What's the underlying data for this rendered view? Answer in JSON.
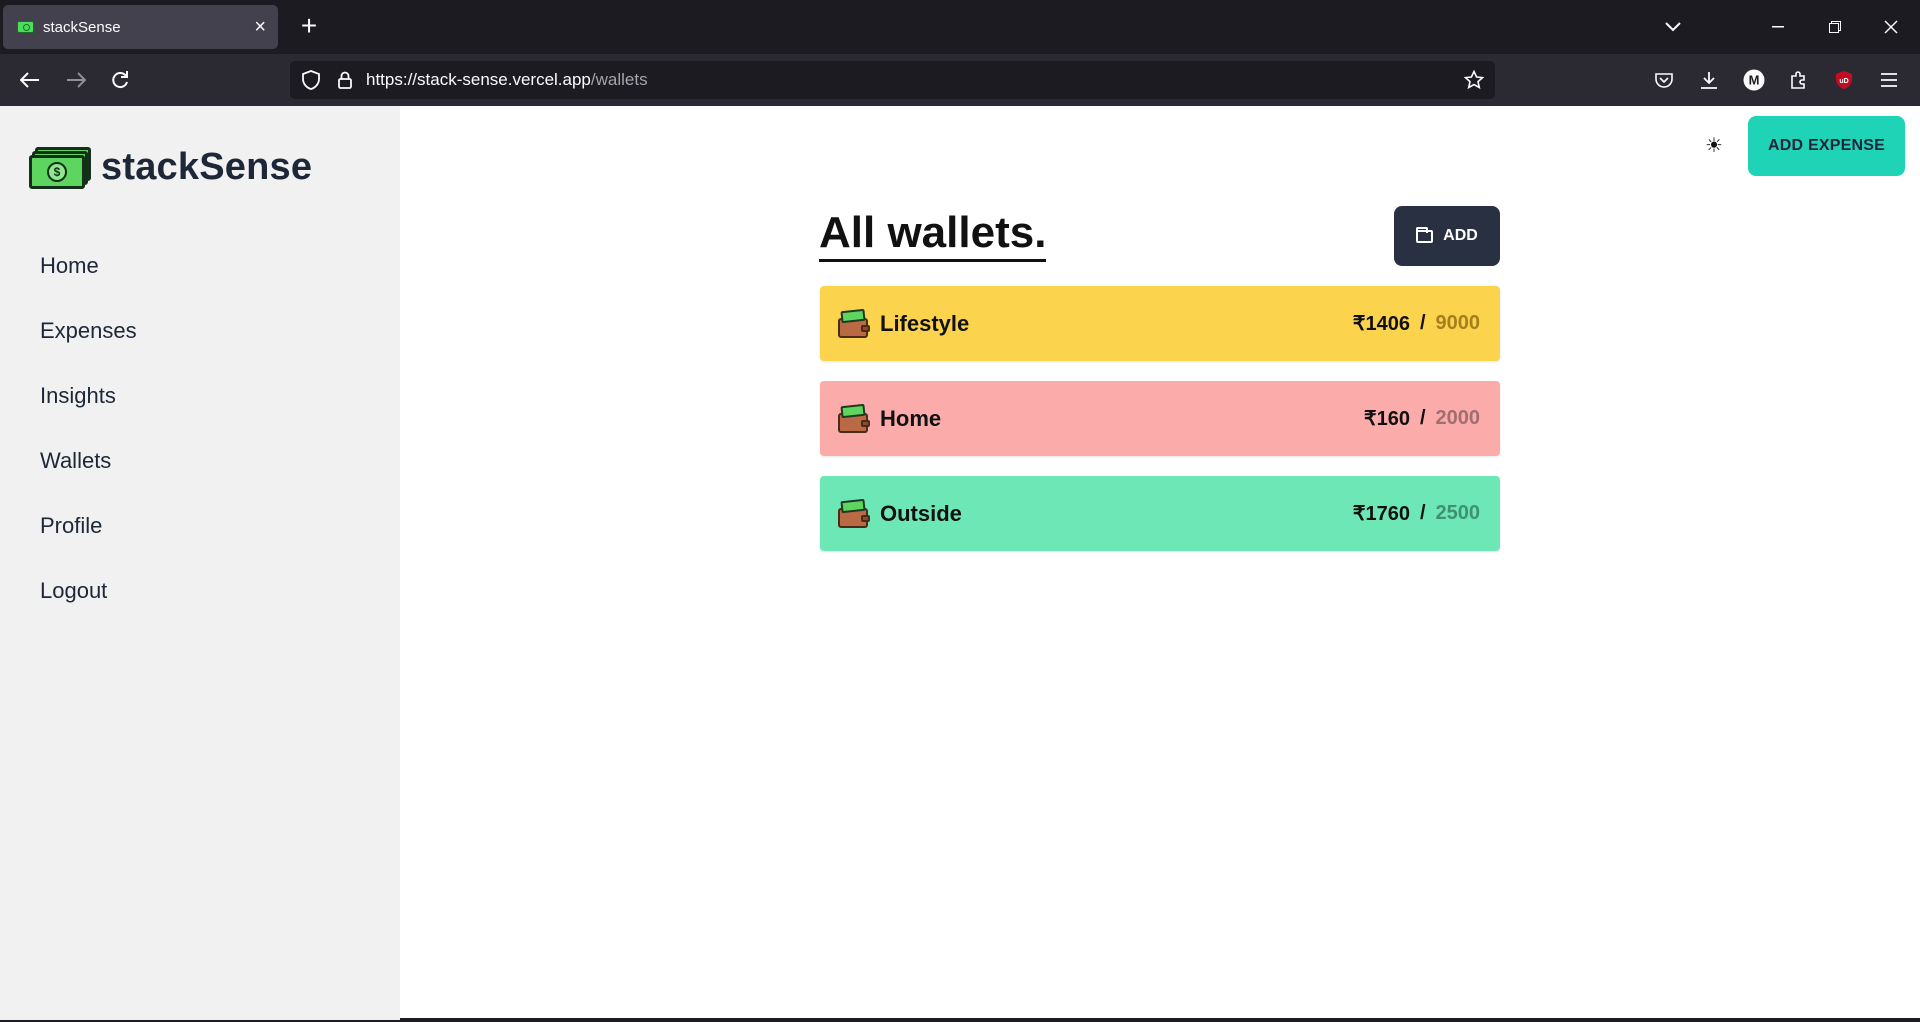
{
  "browser": {
    "tab_title": "stackSense",
    "url_host": "https://stack-sense.vercel.app",
    "url_path": "/wallets"
  },
  "brand": {
    "name": "stackSense"
  },
  "sidebar": {
    "items": [
      {
        "label": "Home"
      },
      {
        "label": "Expenses"
      },
      {
        "label": "Insights"
      },
      {
        "label": "Wallets"
      },
      {
        "label": "Profile"
      },
      {
        "label": "Logout"
      }
    ]
  },
  "header": {
    "theme_icon": "sun-icon",
    "add_expense_label": "ADD EXPENSE"
  },
  "main": {
    "title": "All wallets.",
    "add_label": "ADD",
    "wallets": [
      {
        "name": "Lifestyle",
        "spent": "₹1406",
        "separator": "/",
        "budget": "9000",
        "bg": "#fcd34d",
        "budget_color": "#a37f1f"
      },
      {
        "name": "Home",
        "spent": "₹160",
        "separator": "/",
        "budget": "2000",
        "bg": "#fcabab",
        "budget_color": "#a06e6e"
      },
      {
        "name": "Outside",
        "spent": "₹1760",
        "separator": "/",
        "budget": "2500",
        "bg": "#6ee7b7",
        "budget_color": "#3f9172"
      }
    ]
  },
  "colors": {
    "accent": "#1fd3b6",
    "dark_button": "#283041"
  }
}
